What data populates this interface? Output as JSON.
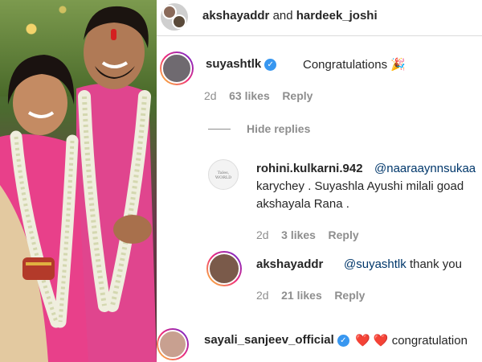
{
  "header": {
    "users": "akshayaddr",
    "and": "and",
    "user2": "hardeek_joshi"
  },
  "comments": [
    {
      "username": "suyashtlk",
      "verified": true,
      "text": "Congratulations",
      "emoji": "🎉",
      "time": "2d",
      "likes": "63 likes",
      "reply": "Reply"
    },
    {
      "username": "rohini.kulkarni.942",
      "mention": "@naaraaynnsukaa",
      "line2": "karychey . Suyashla Ayushi milali goad",
      "line3": "akshayala Rana .",
      "time": "2d",
      "likes": "3 likes",
      "reply": "Reply"
    },
    {
      "username": "akshayaddr",
      "mention": "@suyashtlk",
      "text": "thank you",
      "time": "2d",
      "likes": "21 likes",
      "reply": "Reply"
    },
    {
      "username": "sayali_sanjeev_official",
      "verified": true,
      "hearts": "❤️ ❤️",
      "text": "congratulation"
    }
  ],
  "hide_replies": "Hide replies",
  "avatar_text": "Tales, WORLD"
}
